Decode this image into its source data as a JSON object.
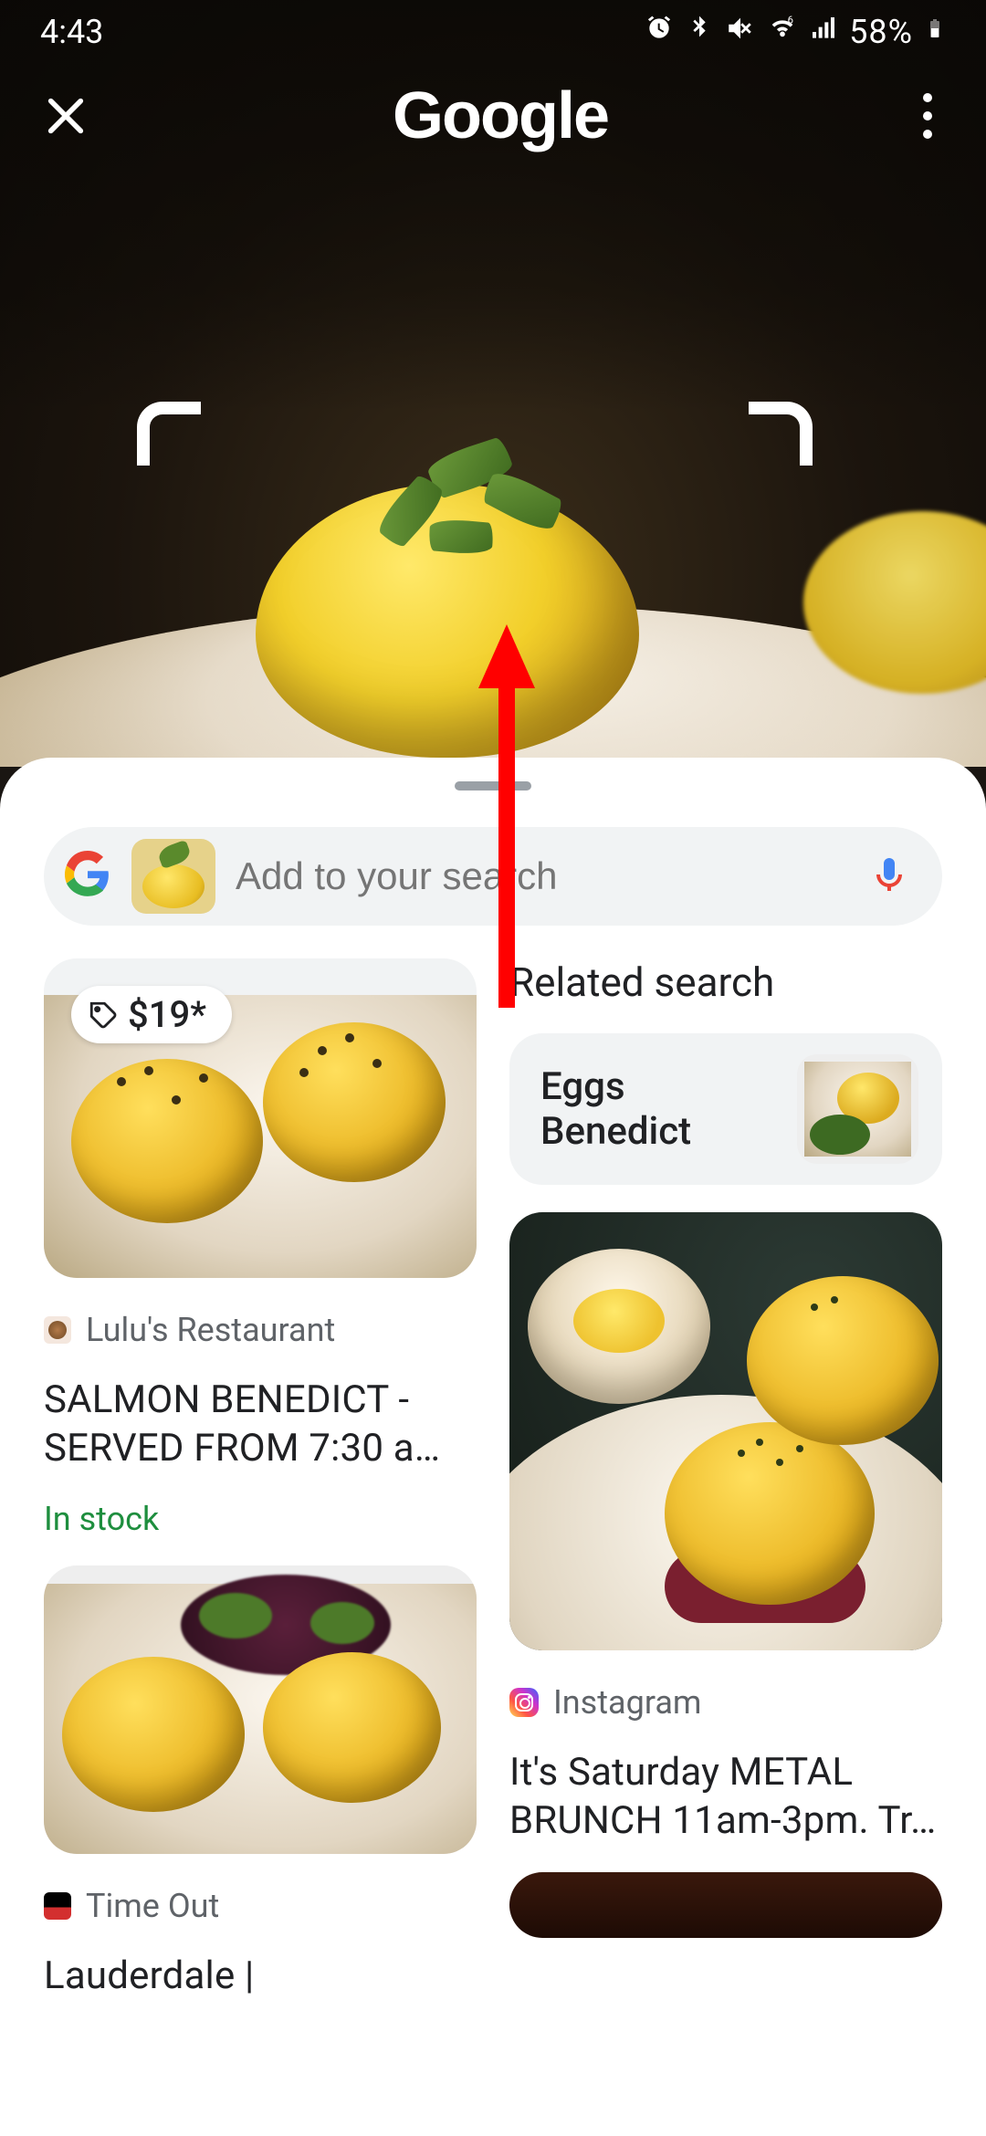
{
  "status": {
    "time": "4:43",
    "battery": "58%"
  },
  "header": {
    "logoText": "Google"
  },
  "search": {
    "placeholder": "Add to your search"
  },
  "related": {
    "heading": "Related search",
    "chipLabel": "Eggs Benedict"
  },
  "results": {
    "left1": {
      "price": "$19*",
      "source": "Lulu's Restaurant",
      "title": "SALMON BENEDICT - SERVED FROM 7:30 a…",
      "stock": "In stock"
    },
    "left2": {
      "source": "Time Out",
      "title": "Lauderdale |"
    },
    "right1": {
      "source": "Instagram",
      "title": "It's Saturday METAL BRUNCH 11am-3pm. Tr…"
    }
  }
}
